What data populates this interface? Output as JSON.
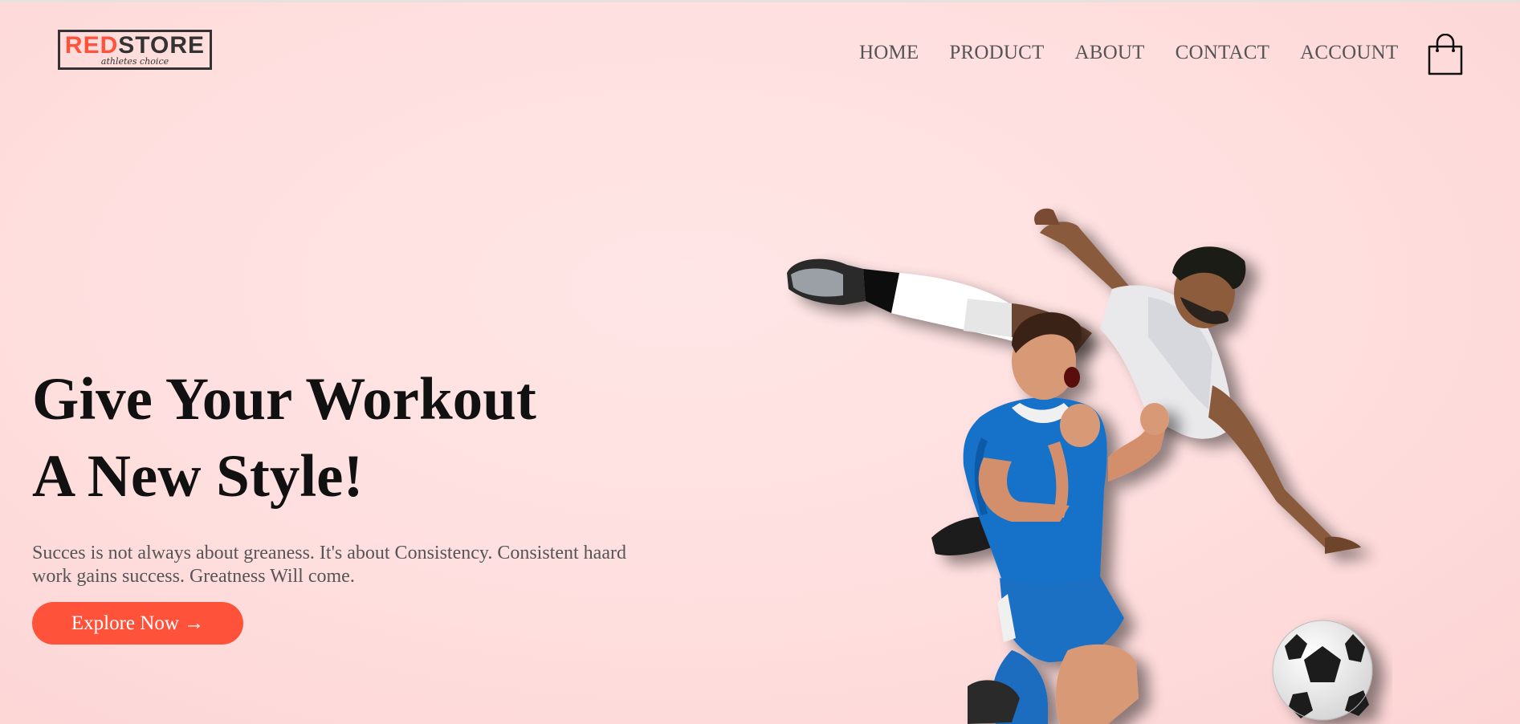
{
  "logo": {
    "text_red": "RED",
    "text_dark": "STORE",
    "tagline": "athletes choice"
  },
  "nav": {
    "items": [
      "HOME",
      "PRODUCT",
      "ABOUT",
      "CONTACT",
      "ACCOUNT"
    ]
  },
  "cart_icon": "shopping-bag-icon",
  "hero": {
    "title_line1": "Give Your Workout",
    "title_line2": "A New Style!",
    "description": "Succes is not always about greaness. It's about Consistency. Consistent haard work gains success. Greatness Will come.",
    "button_label": "Explore Now →"
  },
  "colors": {
    "accent": "#ff523b",
    "background": "#ffe0e0",
    "text_dark": "#111111",
    "text_muted": "#555555"
  }
}
